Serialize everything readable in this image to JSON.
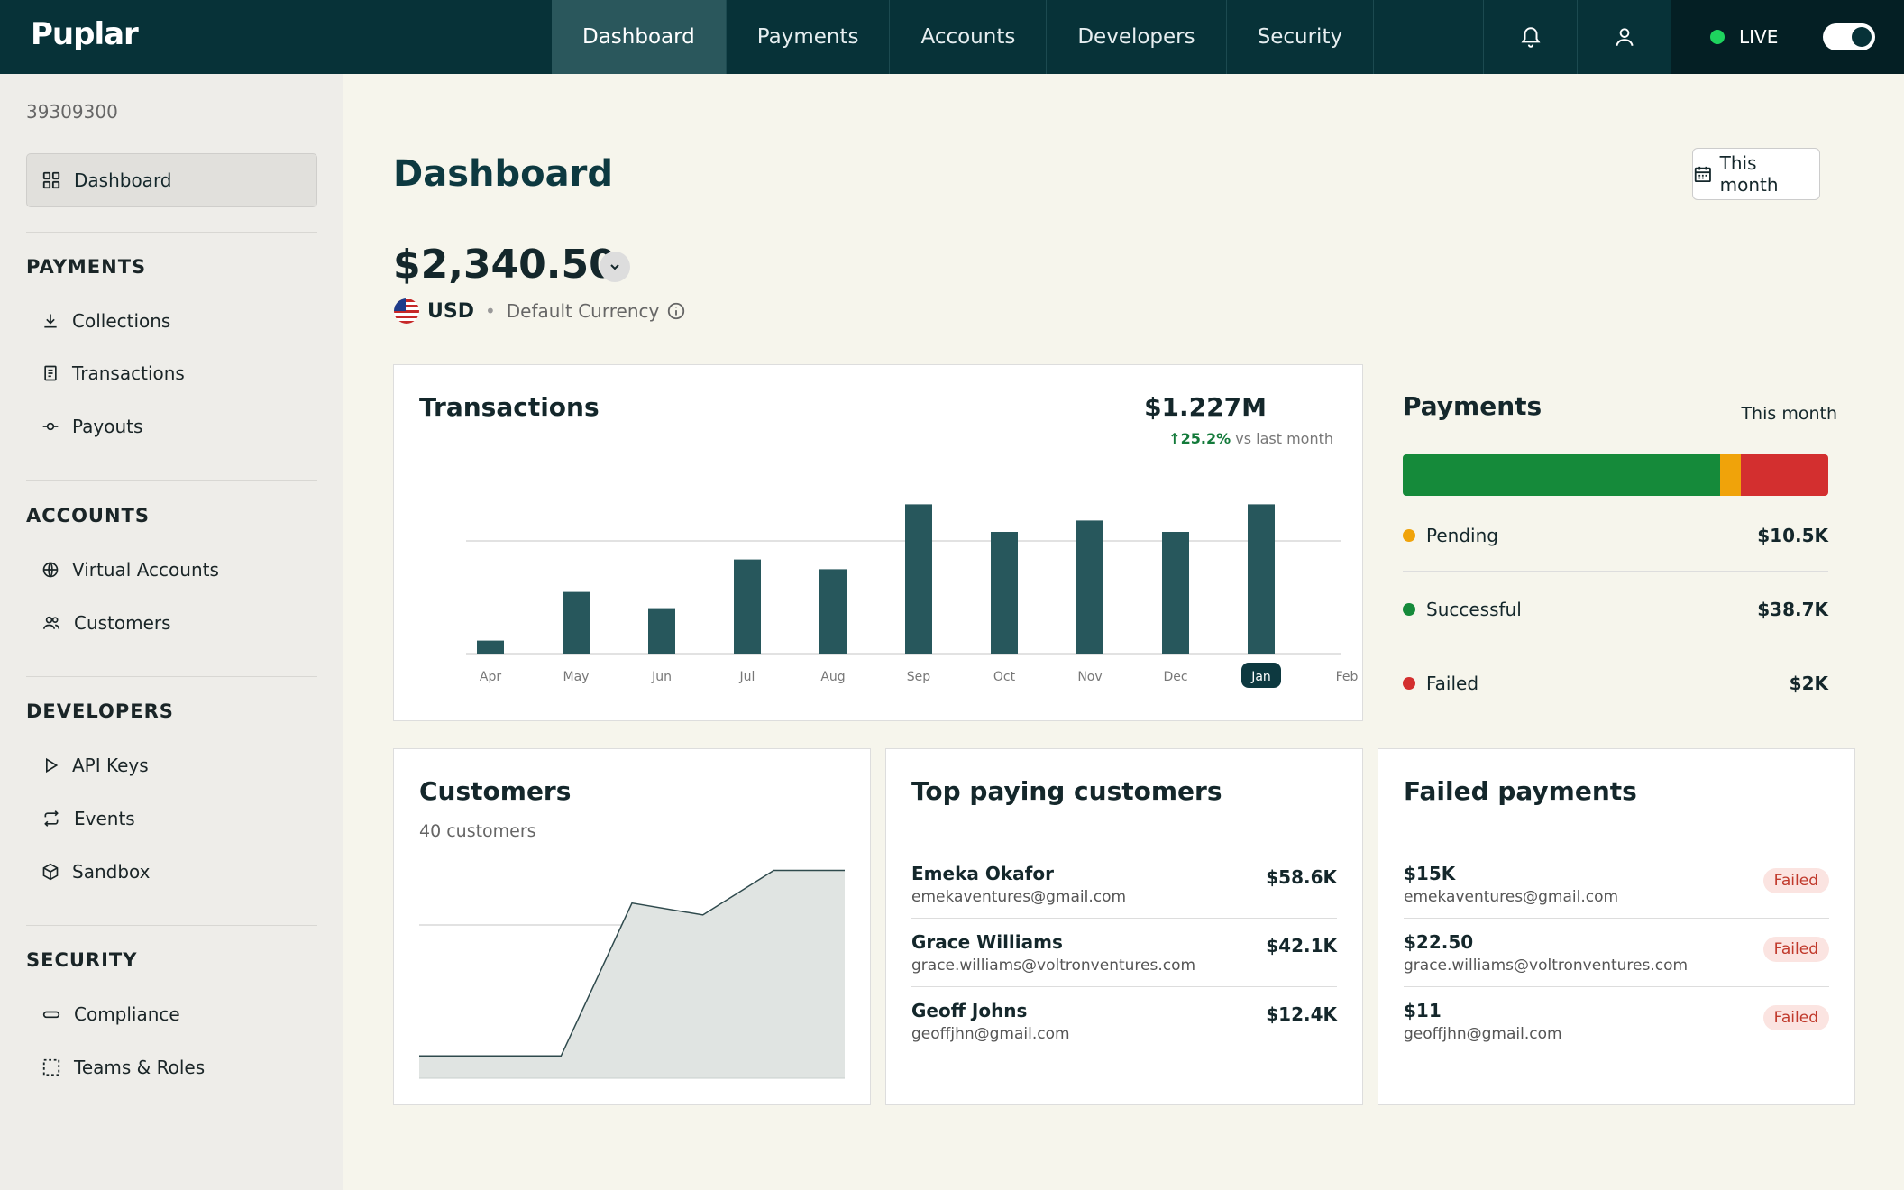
{
  "app": {
    "logo": "Puplar"
  },
  "nav": {
    "tabs": [
      {
        "label": "Dashboard",
        "active": true
      },
      {
        "label": "Payments"
      },
      {
        "label": "Accounts"
      },
      {
        "label": "Developers"
      },
      {
        "label": "Security"
      }
    ],
    "icons": [
      "bell-icon",
      "user-icon"
    ],
    "live_label": "LIVE",
    "live_on": true
  },
  "sidebar": {
    "account_id": "39309300",
    "dashboard": "Dashboard",
    "sections": [
      {
        "title": "PAYMENTS",
        "items": [
          {
            "label": "Collections",
            "icon": "download-icon"
          },
          {
            "label": "Transactions",
            "icon": "document-icon"
          },
          {
            "label": "Payouts",
            "icon": "commit-icon"
          }
        ]
      },
      {
        "title": "ACCOUNTS",
        "items": [
          {
            "label": "Virtual Accounts",
            "icon": "globe-icon"
          },
          {
            "label": "Customers",
            "icon": "users-icon"
          }
        ]
      },
      {
        "title": "DEVELOPERS",
        "items": [
          {
            "label": "API Keys",
            "icon": "play-icon"
          },
          {
            "label": "Events",
            "icon": "repeat-icon"
          },
          {
            "label": "Sandbox",
            "icon": "cube-icon"
          }
        ]
      },
      {
        "title": "SECURITY",
        "items": [
          {
            "label": "Compliance",
            "icon": "pill-icon"
          },
          {
            "label": "Teams & Roles",
            "icon": "dashed-square-icon"
          }
        ]
      }
    ]
  },
  "main": {
    "title": "Dashboard",
    "period_button": "This month",
    "balance": "$2,340.50",
    "currency_code": "USD",
    "currency_note": "Default Currency"
  },
  "transactions": {
    "title": "Transactions",
    "total": "$1.227M",
    "delta": "25.2%",
    "delta_note": "vs last month"
  },
  "payments": {
    "title": "Payments",
    "period": "This month",
    "rows": [
      {
        "label": "Pending",
        "value": "$10.5K",
        "color": "#f0a30a"
      },
      {
        "label": "Successful",
        "value": "$38.7K",
        "color": "#158a3a"
      },
      {
        "label": "Failed",
        "value": "$2K",
        "color": "#d32f2f"
      }
    ],
    "bar_fractions": [
      0.745,
      0.05,
      0.205
    ]
  },
  "customers": {
    "title": "Customers",
    "subtitle": "40 customers"
  },
  "top_customers": {
    "title": "Top paying customers",
    "rows": [
      {
        "name": "Emeka Okafor",
        "email": "emekaventures@gmail.com",
        "amount": "$58.6K"
      },
      {
        "name": "Grace Williams",
        "email": "grace.williams@voltronventures.com",
        "amount": "$42.1K"
      },
      {
        "name": "Geoff Johns",
        "email": "geoffjhn@gmail.com",
        "amount": "$12.4K"
      }
    ]
  },
  "failed_payments": {
    "title": "Failed payments",
    "badge": "Failed",
    "rows": [
      {
        "amount": "$15K",
        "email": "emekaventures@gmail.com"
      },
      {
        "amount": "$22.50",
        "email": "grace.williams@voltronventures.com"
      },
      {
        "amount": "$11",
        "email": "geoffjhn@gmail.com"
      }
    ]
  },
  "chart_data": [
    {
      "type": "bar",
      "categories": [
        "Apr",
        "May",
        "Jun",
        "Jul",
        "Aug",
        "Sep",
        "Oct",
        "Nov",
        "Dec",
        "Jan",
        "Feb"
      ],
      "values": [
        8,
        38,
        28,
        58,
        52,
        92,
        75,
        82,
        75,
        92,
        null
      ],
      "highlight": "Jan",
      "ylim": [
        0,
        100
      ],
      "grid": true,
      "title": "",
      "color": "#27575c"
    },
    {
      "type": "area",
      "x": [
        1,
        2,
        3,
        4,
        5,
        6,
        7
      ],
      "values": [
        15,
        15,
        15,
        118,
        110,
        140,
        140
      ],
      "ylim": [
        0,
        150
      ],
      "grid": true,
      "color": "#e0e4e2"
    }
  ]
}
